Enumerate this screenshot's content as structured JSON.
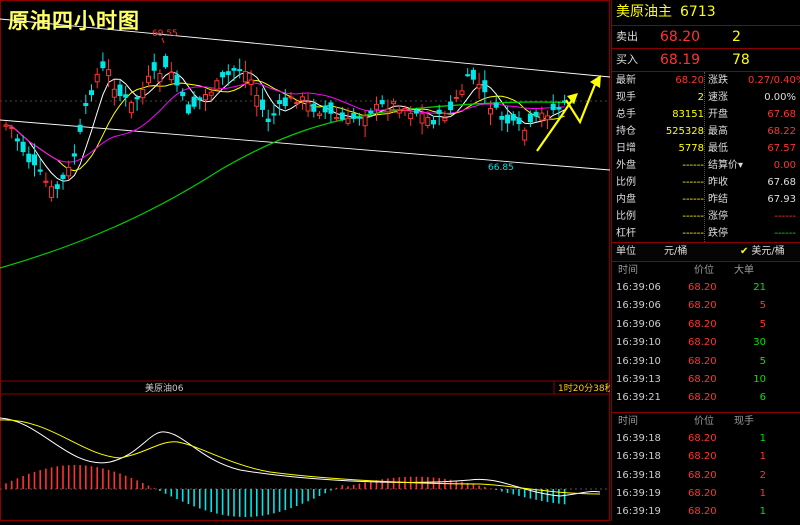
{
  "chart": {
    "overlay_title": "原油四小时图",
    "label_high": "69.55",
    "label_low": "66.85",
    "instrument_label": "美原油06",
    "countdown": "1时20分38秒"
  },
  "symbol": {
    "name": "美原油主",
    "code": "6713"
  },
  "quotes": {
    "sell": {
      "label": "卖出",
      "price": "68.20",
      "volume": "2"
    },
    "buy": {
      "label": "买入",
      "price": "68.19",
      "volume": "78"
    }
  },
  "stats": [
    {
      "l": "最新",
      "v": "68.20",
      "vc": "red",
      "l2": "涨跌",
      "v2": "0.27/0.40%",
      "v2c": "red"
    },
    {
      "l": "现手",
      "v": "2",
      "vc": "yel",
      "l2": "速涨",
      "v2": "0.00%",
      "v2c": "wht"
    },
    {
      "l": "总手",
      "v": "83151",
      "vc": "yel",
      "l2": "开盘",
      "v2": "67.68",
      "v2c": "red"
    },
    {
      "l": "持仓",
      "v": "525328",
      "vc": "yel",
      "l2": "最高",
      "v2": "68.22",
      "v2c": "red"
    },
    {
      "l": "日增",
      "v": "5778",
      "vc": "yel",
      "l2": "最低",
      "v2": "67.57",
      "v2c": "red"
    },
    {
      "l": "外盘",
      "v": "------",
      "vc": "yel",
      "l2": "结算价▾",
      "v2": "0.00",
      "v2c": "red"
    },
    {
      "l": "比例",
      "v": "------",
      "vc": "yel",
      "l2": "昨收",
      "v2": "67.68",
      "v2c": "wht"
    },
    {
      "l": "内盘",
      "v": "------",
      "vc": "yel",
      "l2": "昨结",
      "v2": "67.93",
      "v2c": "wht"
    },
    {
      "l": "比例",
      "v": "------",
      "vc": "yel",
      "l2": "涨停",
      "v2": "------",
      "v2c": "red"
    },
    {
      "l": "杠杆",
      "v": "------",
      "vc": "yel",
      "l2": "跌停",
      "v2": "------",
      "v2c": "grn"
    }
  ],
  "unit_bar": {
    "label": "单位",
    "unit1": "元/桶",
    "check": "✔",
    "unit2": "美元/桶"
  },
  "ticks1": {
    "headers": [
      "时间",
      "价位",
      "大单"
    ],
    "rows": [
      {
        "time": "16:39:06",
        "price": "68.20",
        "vol": "21",
        "vc": "grn"
      },
      {
        "time": "16:39:06",
        "price": "68.20",
        "vol": "5",
        "vc": "red"
      },
      {
        "time": "16:39:06",
        "price": "68.20",
        "vol": "5",
        "vc": "red"
      },
      {
        "time": "16:39:10",
        "price": "68.20",
        "vol": "30",
        "vc": "grn"
      },
      {
        "time": "16:39:10",
        "price": "68.20",
        "vol": "5",
        "vc": "grn"
      },
      {
        "time": "16:39:13",
        "price": "68.20",
        "vol": "10",
        "vc": "grn"
      },
      {
        "time": "16:39:21",
        "price": "68.20",
        "vol": "6",
        "vc": "grn"
      }
    ]
  },
  "ticks2": {
    "headers": [
      "时间",
      "价位",
      "现手"
    ],
    "rows": [
      {
        "time": "16:39:18",
        "price": "68.20",
        "vol": "1",
        "vc": "grn"
      },
      {
        "time": "16:39:18",
        "price": "68.20",
        "vol": "1",
        "vc": "red"
      },
      {
        "time": "16:39:18",
        "price": "68.20",
        "vol": "2",
        "vc": "red"
      },
      {
        "time": "16:39:19",
        "price": "68.20",
        "vol": "1",
        "vc": "red"
      },
      {
        "time": "16:39:19",
        "price": "68.20",
        "vol": "1",
        "vc": "grn"
      }
    ]
  },
  "colors": {
    "up": "#ff3333",
    "down": "#00e5e5",
    "frame": "#8a0000",
    "ma_white": "#ffffff",
    "ma_yellow": "#ffff00",
    "ma_magenta": "#ff00ff",
    "ma_green": "#00cc00"
  }
}
